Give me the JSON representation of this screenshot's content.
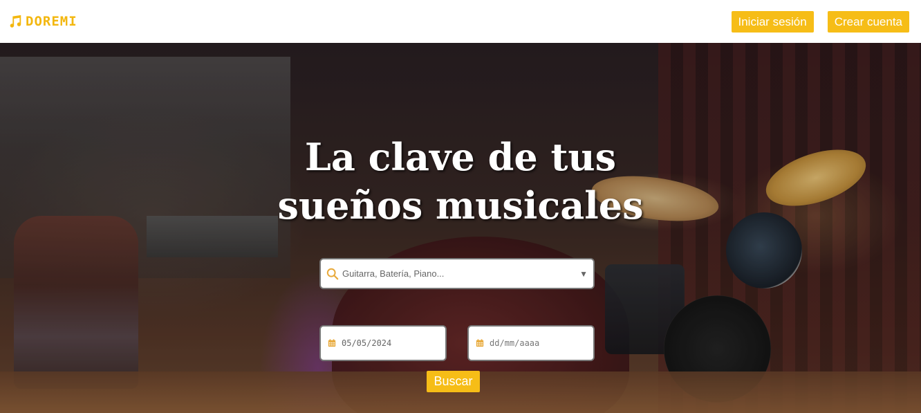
{
  "brand": {
    "name": "DOREMI",
    "icon": "music-note-icon",
    "color": "#f3b70f"
  },
  "header": {
    "login_label": "Iniciar sesión",
    "signup_label": "Crear cuenta"
  },
  "hero": {
    "title_line1": "La clave de tus",
    "title_line2": "sueños musicales"
  },
  "search": {
    "instrument_placeholder": "Guitarra, Batería, Piano...",
    "search_icon": "search-icon",
    "dropdown_icon": "chevron-down-icon",
    "start_date_value": "05/05/2024",
    "end_date_placeholder": "dd/mm/aaaa",
    "calendar_icon": "calendar-icon",
    "submit_label": "Buscar"
  },
  "colors": {
    "accent": "#f6bd17",
    "button_text": "#ffffff"
  }
}
